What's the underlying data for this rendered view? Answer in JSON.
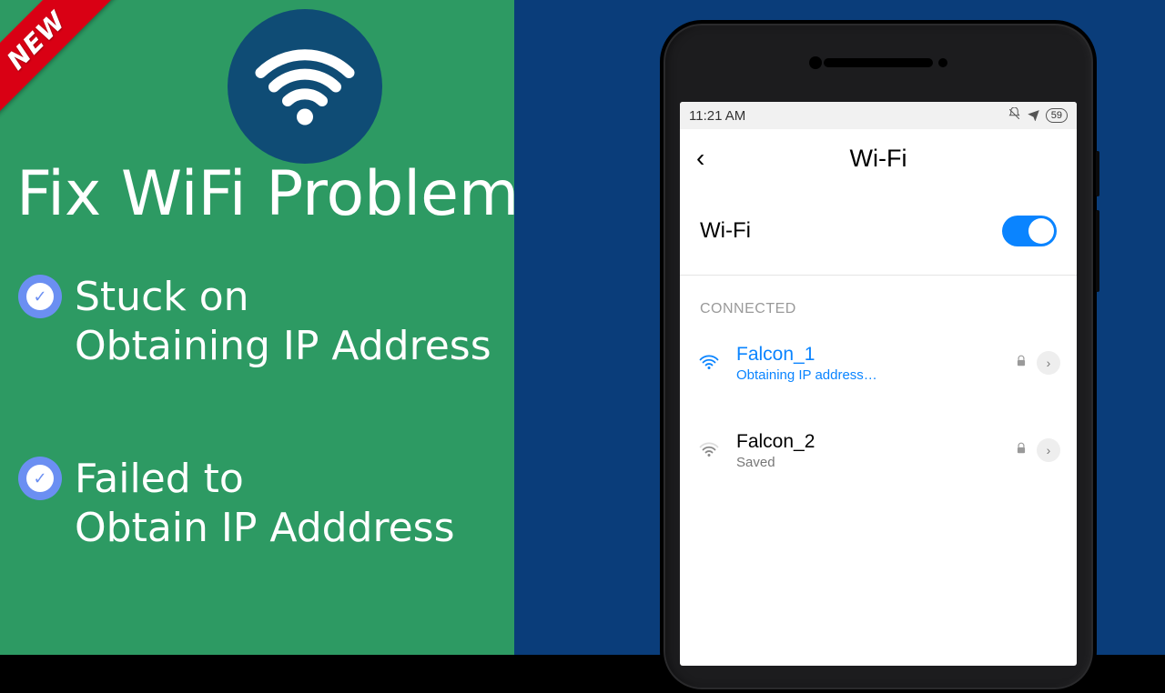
{
  "left": {
    "new_badge": "NEW",
    "heading": "Fix WiFi Problem",
    "bullets": [
      "Stuck on\nObtaining IP Address",
      "Failed to\nObtain IP Adddress"
    ]
  },
  "phone": {
    "status": {
      "time": "11:21 AM",
      "battery": "59"
    },
    "title": "Wi-Fi",
    "toggle_label": "Wi-Fi",
    "section_label": "CONNECTED",
    "networks": [
      {
        "name": "Falcon_1",
        "sub": "Obtaining IP address…",
        "active": true
      },
      {
        "name": "Falcon_2",
        "sub": "Saved",
        "active": false
      }
    ]
  }
}
